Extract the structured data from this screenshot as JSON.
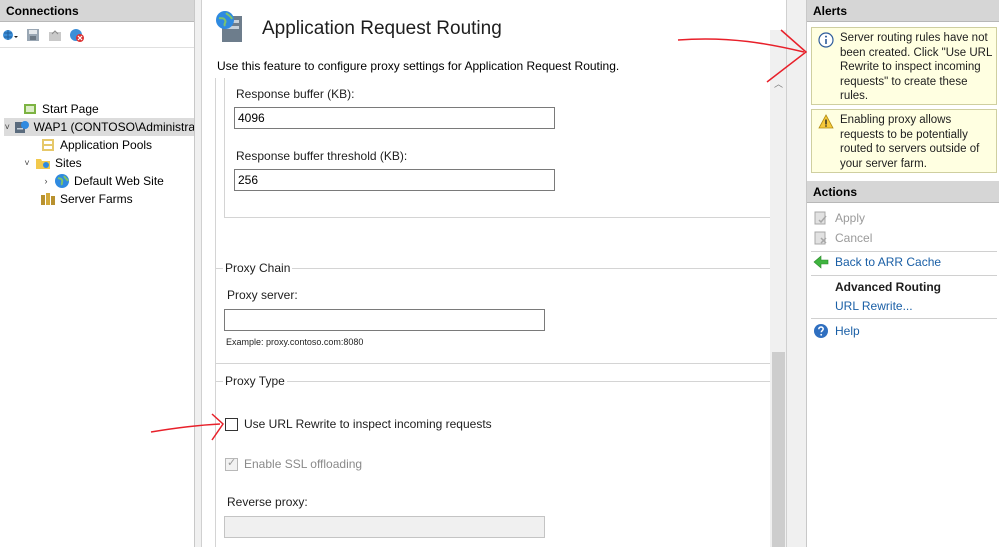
{
  "connections": {
    "title": "Connections",
    "tree": [
      {
        "label": "Start Page",
        "icon": "start-page-icon"
      },
      {
        "label": "WAP1 (CONTOSO\\Administra",
        "icon": "server-icon"
      },
      {
        "label": "Application Pools",
        "icon": "app-pools-icon"
      },
      {
        "label": "Sites",
        "icon": "sites-folder-icon"
      },
      {
        "label": "Default Web Site",
        "icon": "globe-icon"
      },
      {
        "label": "Server Farms",
        "icon": "server-farms-icon"
      }
    ]
  },
  "center": {
    "title": "Application Request Routing",
    "description": "Use this feature to configure proxy settings for Application Request Routing.",
    "response_buffer_label": "Response buffer (KB):",
    "response_buffer_value": "4096",
    "response_buffer_threshold_label": "Response buffer threshold (KB):",
    "response_buffer_threshold_value": "256",
    "proxy_chain_title": "Proxy Chain",
    "proxy_server_label": "Proxy server:",
    "proxy_server_value": "",
    "proxy_server_example": "Example: proxy.contoso.com:8080",
    "proxy_type_title": "Proxy Type",
    "use_url_rewrite_label": "Use URL Rewrite to inspect incoming requests",
    "use_url_rewrite_checked": false,
    "enable_ssl_offloading_label": "Enable SSL offloading",
    "enable_ssl_offloading_checked": true,
    "reverse_proxy_label": "Reverse proxy:",
    "reverse_proxy_value": ""
  },
  "alerts": {
    "title": "Alerts",
    "items": [
      {
        "icon": "info-icon",
        "text": "Server routing rules have not been created. Click \"Use URL Rewrite to inspect incoming requests\" to create these rules."
      },
      {
        "icon": "warning-icon",
        "text": "Enabling proxy allows requests to be potentially routed to servers outside of your server farm."
      }
    ]
  },
  "actions": {
    "title": "Actions",
    "apply": "Apply",
    "cancel": "Cancel",
    "back": "Back to ARR Cache",
    "advanced_routing": "Advanced Routing",
    "url_rewrite": "URL Rewrite...",
    "help": "Help"
  },
  "colors": {
    "link": "#1a5fa6",
    "alert_bg": "#ffffe1",
    "annotation": "#e8202a"
  }
}
